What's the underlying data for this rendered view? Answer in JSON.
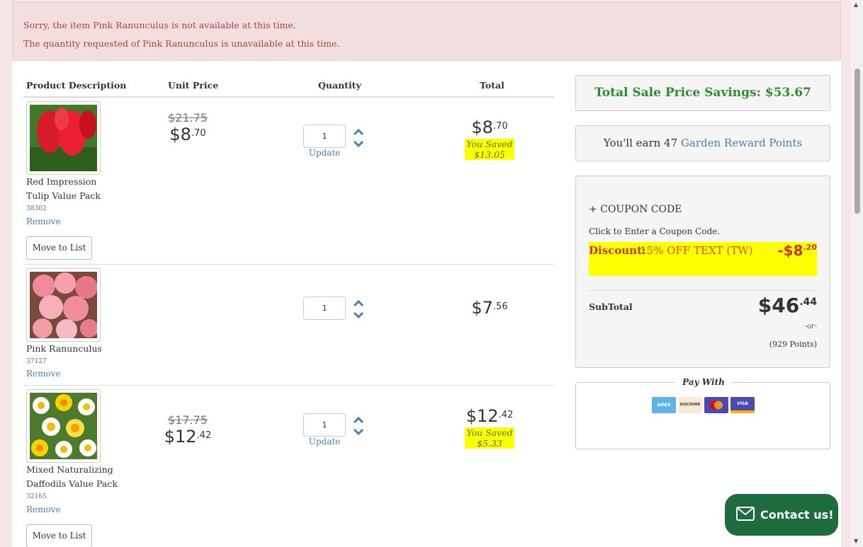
{
  "alerts": [
    "Sorry, the item Pink Ranunculus is not available at this time.",
    "The quantity requested of Pink Ranunculus is unavailable at this time."
  ],
  "table": {
    "headers": [
      "Product Description",
      "Unit Price",
      "Quantity",
      "Total"
    ],
    "update_label": "Update",
    "remove_label": "Remove",
    "move_label": "Move to List",
    "items": [
      {
        "name": "Red Impression Tulip Value Pack",
        "sku": "38302",
        "orig_price": "$21.75",
        "price_dollars": "$8",
        "price_cents": ".70",
        "qty": "1",
        "total_dollars": "$8",
        "total_cents": ".70",
        "saved_label": "You Saved",
        "saved_amount": "$13.05"
      },
      {
        "name": "Pink Ranunculus",
        "sku": "37127",
        "qty": "1",
        "total_dollars": "$7",
        "total_cents": ".56"
      },
      {
        "name": "Mixed Naturalizing Daffodils Value Pack",
        "sku": "32165",
        "orig_price": "$17.75",
        "price_dollars": "$12",
        "price_cents": ".42",
        "qty": "1",
        "total_dollars": "$12",
        "total_cents": ".42",
        "saved_label": "You Saved",
        "saved_amount": "$5.33"
      }
    ]
  },
  "summary": {
    "savings": "Total Sale Price Savings: $53.67",
    "reward_prefix": "You'll earn 47",
    "reward_link": "Garden Reward Points",
    "coupon_title": "+ COUPON CODE",
    "coupon_hint": "Click to Enter a Coupon Code.",
    "discount_label": "Discount:",
    "discount_code": "15% OFF TEXT (TW)",
    "discount_dollars": "-$8",
    "discount_cents": ".20",
    "subtotal_label": "SubTotal",
    "subtotal_dollars": "$46",
    "subtotal_cents": ".44",
    "or_label": "-or-",
    "points_label": "(929 Points)"
  },
  "pay": {
    "label": "Pay With",
    "cards": [
      "AMEX",
      "DISCOVER",
      "MC",
      "VISA"
    ]
  },
  "contact_label": "Contact us!",
  "colors": {
    "alert_bg": "#f2dede",
    "alert_text": "#a94442",
    "savings_green": "#2e8b2e",
    "highlight": "#ffff00",
    "link": "#4a7fb5",
    "contact_bg": "#1e6b3e"
  }
}
